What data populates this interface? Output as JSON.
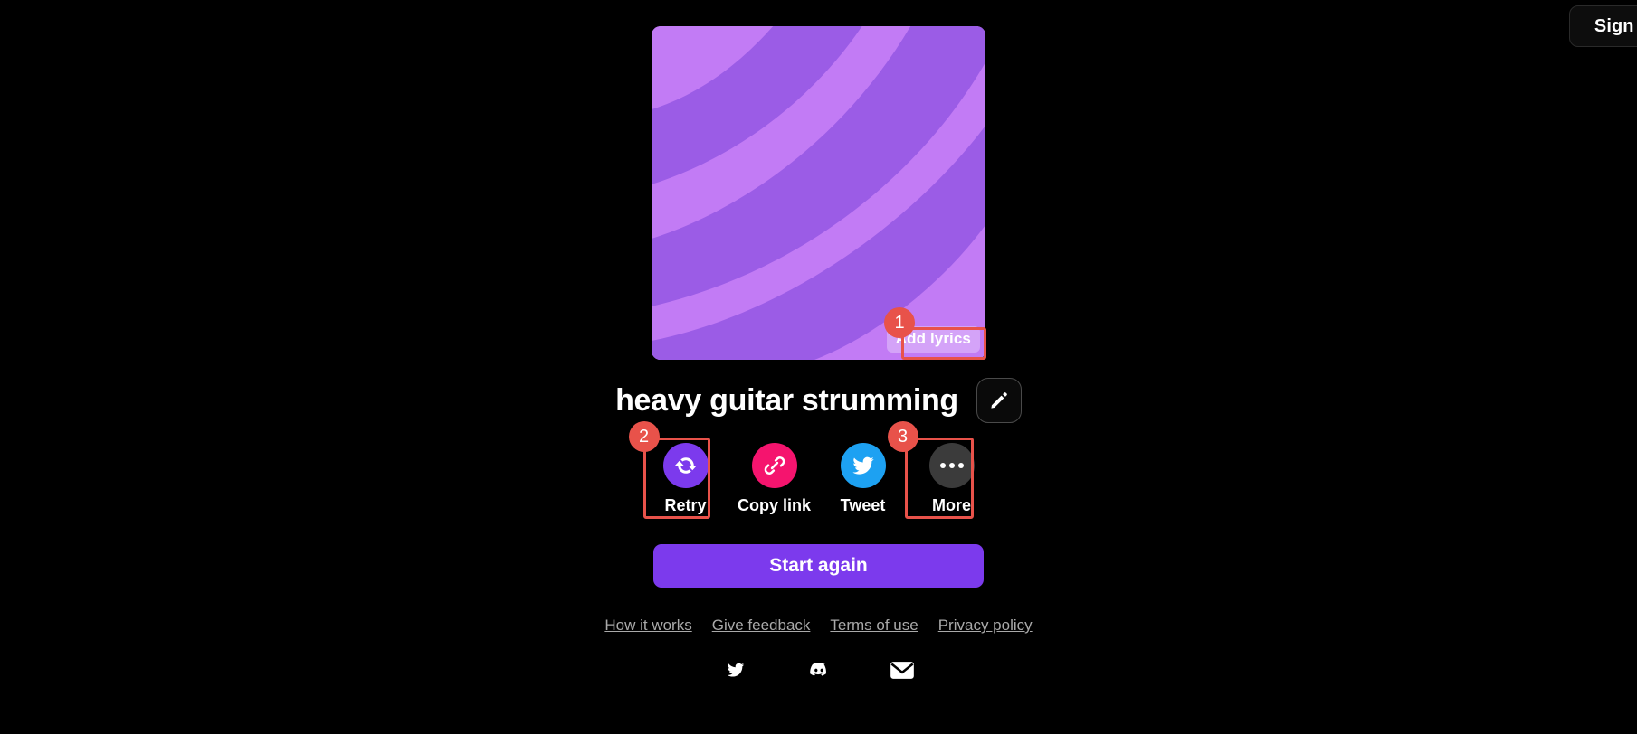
{
  "header": {
    "signup_label": "Sign Up"
  },
  "artwork": {
    "alt_name": "generated-cover-art",
    "colors": {
      "light": "#c27bf5",
      "dark": "#9b5ce6"
    },
    "add_lyrics_label": "Add lyrics"
  },
  "track": {
    "title": "heavy guitar strumming",
    "edit_icon": "pencil-icon"
  },
  "actions": [
    {
      "label": "Retry",
      "icon": "refresh-icon",
      "color": "#7c3aed",
      "name": "retry"
    },
    {
      "label": "Copy link",
      "icon": "link-icon",
      "color": "#f5146e",
      "name": "copy-link"
    },
    {
      "label": "Tweet",
      "icon": "twitter-icon",
      "color": "#1da1f2",
      "name": "tweet"
    },
    {
      "label": "More",
      "icon": "ellipsis-icon",
      "color": "#3b3b3b",
      "name": "more"
    }
  ],
  "primary_button": {
    "label": "Start again"
  },
  "footer": {
    "links": [
      {
        "label": "How it works"
      },
      {
        "label": "Give feedback"
      },
      {
        "label": "Terms of use"
      },
      {
        "label": "Privacy policy"
      }
    ],
    "socials": [
      {
        "icon": "twitter-icon"
      },
      {
        "icon": "discord-icon"
      },
      {
        "icon": "email-icon"
      }
    ]
  },
  "annotations": [
    {
      "number": "1",
      "target": "add-lyrics-button"
    },
    {
      "number": "2",
      "target": "retry-action"
    },
    {
      "number": "3",
      "target": "more-action"
    }
  ],
  "colors": {
    "background": "#000000",
    "accent_purple": "#7c3aed",
    "annotation_red": "#e8524a"
  }
}
